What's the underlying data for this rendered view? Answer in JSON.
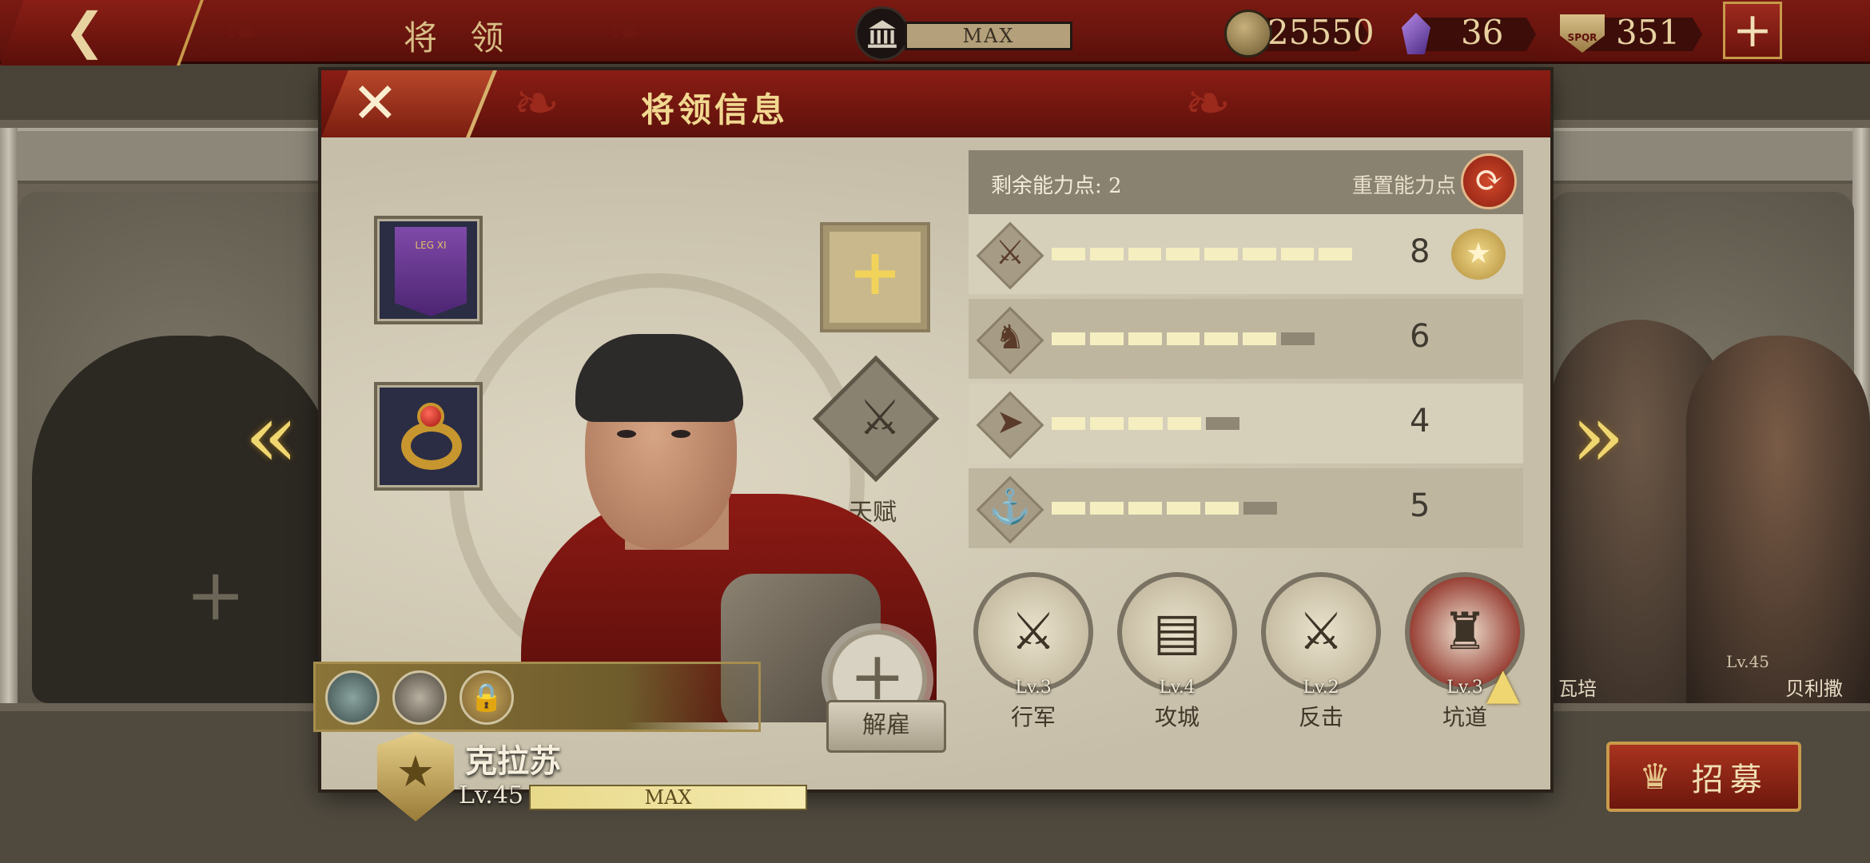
{
  "topbar": {
    "title": "将 领",
    "max_label": "MAX",
    "coins": "25550",
    "gems": "36",
    "spqr": "351",
    "spqr_badge": "SPQR"
  },
  "dialog": {
    "title": "将领信息"
  },
  "equipment": {
    "banner_text": "LEG XI"
  },
  "talent": {
    "label": "天赋"
  },
  "general": {
    "name": "克拉苏",
    "level": "Lv.45",
    "xp_label": "MAX",
    "xp_fraction": 1.0,
    "dismiss_label": "解雇"
  },
  "stats": {
    "points_label": "剩余能力点: 2",
    "reset_label": "重置能力点",
    "rows": [
      {
        "icon": "sword-icon",
        "value": "8",
        "filled": 8,
        "total": 8
      },
      {
        "icon": "horse-icon",
        "value": "6",
        "filled": 6,
        "total": 7
      },
      {
        "icon": "bow-icon",
        "value": "4",
        "filled": 4,
        "total": 5
      },
      {
        "icon": "anchor-icon",
        "value": "5",
        "filled": 5,
        "total": 6
      }
    ]
  },
  "skills": [
    {
      "level": "Lv.3",
      "name": "行军"
    },
    {
      "level": "Lv.4",
      "name": "攻城"
    },
    {
      "level": "Lv.2",
      "name": "反击"
    },
    {
      "level": "Lv.3",
      "name": "坑道"
    }
  ],
  "background": {
    "right_name_1": "瓦培",
    "right_name_2": "贝利撒",
    "right_level": "Lv.45"
  },
  "recruit": {
    "label": "招募"
  }
}
